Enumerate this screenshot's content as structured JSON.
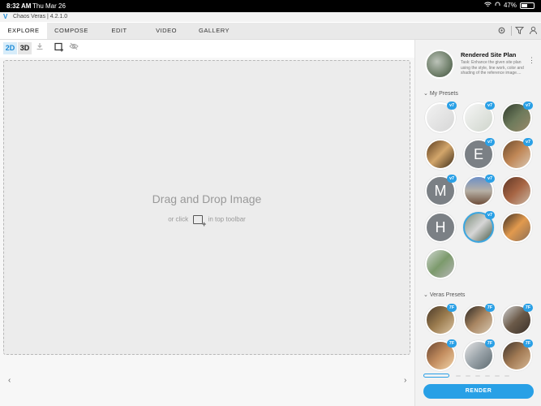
{
  "status": {
    "time": "8:32 AM",
    "date": "Thu Mar 26",
    "battery": "47%",
    "battery_fraction": 0.47
  },
  "app": {
    "title": "Chaos Veras | 4.2.1.0",
    "logo": "V",
    "accent": "#2aa0e6"
  },
  "tabs": [
    {
      "label": "EXPLORE",
      "active": true
    },
    {
      "label": "COMPOSE"
    },
    {
      "label": "EDIT"
    },
    {
      "label": "VIDEO"
    },
    {
      "label": "GALLERY"
    }
  ],
  "toolbar": {
    "btn_2d": "2D",
    "btn_3d": "3D"
  },
  "canvas": {
    "drop_title": "Drag and Drop Image",
    "drop_sub_before": "or click",
    "drop_sub_after": "in top toolbar",
    "nav_left": "‹",
    "nav_right": "›"
  },
  "preset": {
    "title": "Rendered Site Plan",
    "description": "Task: Enhance the given site plan using the style, line work, color and shading of the reference image....",
    "more": "⋮"
  },
  "my_presets": {
    "heading": "My Presets",
    "items": [
      {
        "kind": "image",
        "badge": "v7"
      },
      {
        "kind": "image",
        "badge": "v7"
      },
      {
        "kind": "image",
        "badge": "v7"
      },
      {
        "kind": "image",
        "badge": ""
      },
      {
        "kind": "letter",
        "letter": "E",
        "badge": "v7"
      },
      {
        "kind": "image",
        "badge": "v7"
      },
      {
        "kind": "letter",
        "letter": "M",
        "badge": "v7"
      },
      {
        "kind": "image",
        "badge": "v7"
      },
      {
        "kind": "image",
        "badge": ""
      },
      {
        "kind": "letter",
        "letter": "H",
        "badge": ""
      },
      {
        "kind": "image",
        "badge": "v7",
        "selected": true
      },
      {
        "kind": "image",
        "badge": ""
      },
      {
        "kind": "image",
        "badge": ""
      }
    ]
  },
  "veras_presets": {
    "heading": "Veras Presets",
    "items": [
      {
        "badge": "7F"
      },
      {
        "badge": "7F"
      },
      {
        "badge": "7F"
      },
      {
        "badge": "7F"
      },
      {
        "badge": "7F"
      },
      {
        "badge": "7F"
      }
    ]
  },
  "render": {
    "label": "RENDER"
  },
  "icons": [
    "settings-icon",
    "filter-icon",
    "user-icon",
    "download-icon",
    "add-image-icon",
    "hide-icon",
    "chevron-down-icon"
  ]
}
